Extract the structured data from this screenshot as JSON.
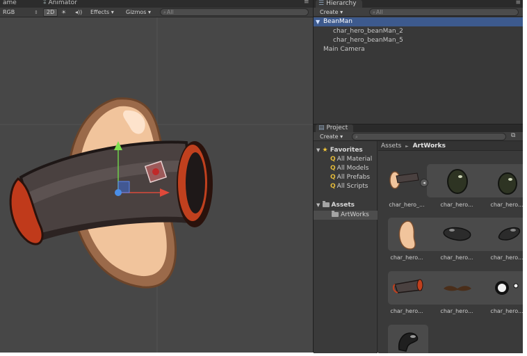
{
  "scene_tabs": [
    "ame",
    "Animator"
  ],
  "scene_toolbar": {
    "render_mode": "RGB",
    "mode_2d": "2D",
    "sun_glyph": "☀",
    "audio_glyph": "◂))",
    "effects": "Effects ▾",
    "gizmos": "Gizmos ▾",
    "search_placeholder": "All",
    "search_glyph": "⌕"
  },
  "hierarchy": {
    "tab_label": "Hierarchy",
    "tab_icon": "☰",
    "menu_glyph": "≡",
    "create_label": "Create ▾",
    "search_placeholder": "All",
    "items": [
      {
        "label": "BeanMan",
        "arrow": "▼"
      },
      {
        "label": "char_hero_beanMan_2"
      },
      {
        "label": "char_hero_beanMan_5"
      },
      {
        "label": "Main Camera"
      }
    ]
  },
  "project": {
    "tab_label": "Project",
    "tab_icon": "▤",
    "menu_glyph": "≡",
    "create_label": "Create ▾",
    "favorites": {
      "arrow": "▼",
      "star": "★",
      "label": "Favorites",
      "items": [
        "All Material",
        "All Models",
        "All Prefabs",
        "All Scripts"
      ],
      "item_glyph": "Q"
    },
    "assets_tree": {
      "arrow": "▼",
      "label": "Assets",
      "child": "ArtWorks"
    },
    "breadcrumb": {
      "root": "Assets",
      "sep": "►",
      "current": "ArtWorks"
    },
    "asset_labels": [
      "char_hero_...",
      "char_hero...",
      "char_hero...",
      "char_hero...",
      "char_hero...",
      "char_hero...",
      "char_hero...",
      "char_hero...",
      "char_hero..."
    ]
  },
  "colors": {
    "selection": "#3d5a8e",
    "panel": "#383838",
    "viewport": "#474747",
    "bean_skin": "#f3c6a0",
    "bean_outline": "#7a4d2e",
    "pipe_rim": "#b83a1a"
  }
}
